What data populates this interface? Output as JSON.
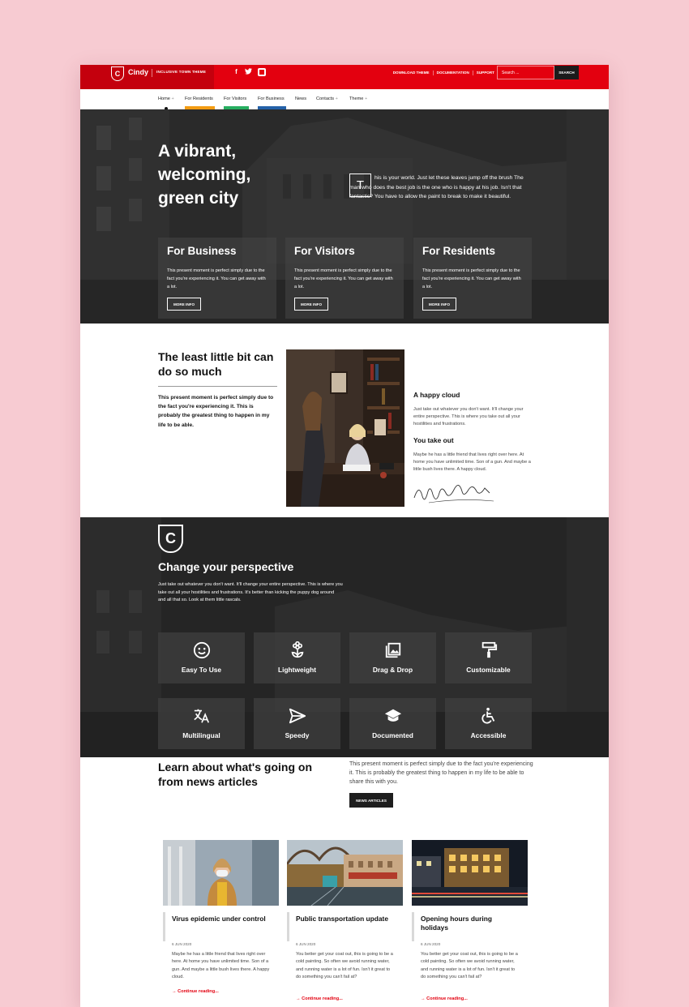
{
  "header": {
    "logo_letter": "C",
    "brand_name": "Cindy",
    "tagline": "INCLUSIVE TOWN THEME",
    "social_icons": [
      "facebook-icon",
      "twitter-icon",
      "foursquare-icon"
    ],
    "links": [
      "DOWNLOAD THEME",
      "DOCUMENTATION",
      "SUPPORT"
    ],
    "search_placeholder": "Search ...",
    "search_button": "SEARCH",
    "brand_color": "#e3000f"
  },
  "nav": {
    "items": [
      {
        "label": "Home",
        "has_caret": true
      },
      {
        "label": "For Residents",
        "color": "#f39c12"
      },
      {
        "label": "For Visitors",
        "color": "#27ae60"
      },
      {
        "label": "For Business",
        "color": "#2461a8"
      },
      {
        "label": "News"
      },
      {
        "label": "Contacts",
        "has_caret": true
      },
      {
        "label": "Theme",
        "has_caret": true
      }
    ],
    "caret": "+"
  },
  "hero": {
    "title": "A vibrant, welcoming, green city",
    "dropcap": "T",
    "text": "his is your world. Just let these leaves jump off the brush The man who does the best job is the one who is happy at his job. Isn't that fantastic? You have to allow the paint to break to make it beautiful.",
    "cards": [
      {
        "title": "For Business",
        "text": "This present moment is perfect simply due to the fact you're experiencing it. You can get away with a lot.",
        "button": "MORE INFO"
      },
      {
        "title": "For Visitors",
        "text": "This present moment is perfect simply due to the fact you're experiencing it. You can get away with a lot.",
        "button": "MORE INFO"
      },
      {
        "title": "For Residents",
        "text": "This present moment is perfect simply due to the fact you're experiencing it. You can get away with a lot.",
        "button": "MORE INFO"
      }
    ]
  },
  "about": {
    "title": "The least little bit can do so much",
    "lead": "This present moment is perfect simply due to the fact you're experiencing it. This is probably the greatest thing to happen in my life to be able.",
    "side": [
      {
        "heading": "A happy cloud",
        "text": "Just take out whatever you don't want. It'll change your entire perspective. This is where you take out all your hostilities and frustrations."
      },
      {
        "heading": "You take out",
        "text": "Maybe he has a little friend that lives right over here. At home you have unlimited time. Son of a gun. And maybe a little bush lives there. A happy cloud."
      }
    ],
    "signature": "WebbaryDesign.eu"
  },
  "features": {
    "logo_letter": "C",
    "title": "Change your perspective",
    "description": "Just take out whatever you don't want. It'll change your entire perspective. This is where you take out all your hostilities and frustrations. It's better than kicking the puppy dog around and all that so. Look at them little rascals.",
    "tiles": [
      {
        "label": "Easy To Use",
        "icon": "smile-icon"
      },
      {
        "label": "Lightweight",
        "icon": "flower-icon"
      },
      {
        "label": "Drag & Drop",
        "icon": "image-gallery-icon"
      },
      {
        "label": "Customizable",
        "icon": "paint-roller-icon"
      },
      {
        "label": "Multilingual",
        "icon": "translate-icon"
      },
      {
        "label": "Speedy",
        "icon": "paper-plane-icon"
      },
      {
        "label": "Documented",
        "icon": "graduation-cap-icon"
      },
      {
        "label": "Accessible",
        "icon": "wheelchair-icon"
      }
    ]
  },
  "news": {
    "title": "Learn about what's going on from news articles",
    "description": "This present moment is perfect simply due to the fact you're experiencing it. This is probably the greatest thing to happen in my life to be able to share this with you.",
    "button": "NEWS ARTICLES",
    "articles": [
      {
        "title": "Virus epidemic under control",
        "date": "6 JUN 2020",
        "text": "Maybe he has a little friend that lives right over here. At home you have unlimited time. Son of a gun. And maybe a little bush lives there. A happy cloud.",
        "more": "→ Continue reading..."
      },
      {
        "title": "Public transportation update",
        "date": "6 JUN 2020",
        "text": "You better get your coat out, this is going to be a cold painting. So often we avoid running water, and running water is a lot of fun. Isn't it great to do something you can't fail at?",
        "more": "→ Continue reading..."
      },
      {
        "title": "Opening hours during holidays",
        "date": "6 JUN 2020",
        "text": "You better get your coat out, this is going to be a cold painting. So often we avoid running water, and running water is a lot of fun. Isn't it great to do something you can't fail at?",
        "more": "→ Continue reading..."
      }
    ]
  }
}
